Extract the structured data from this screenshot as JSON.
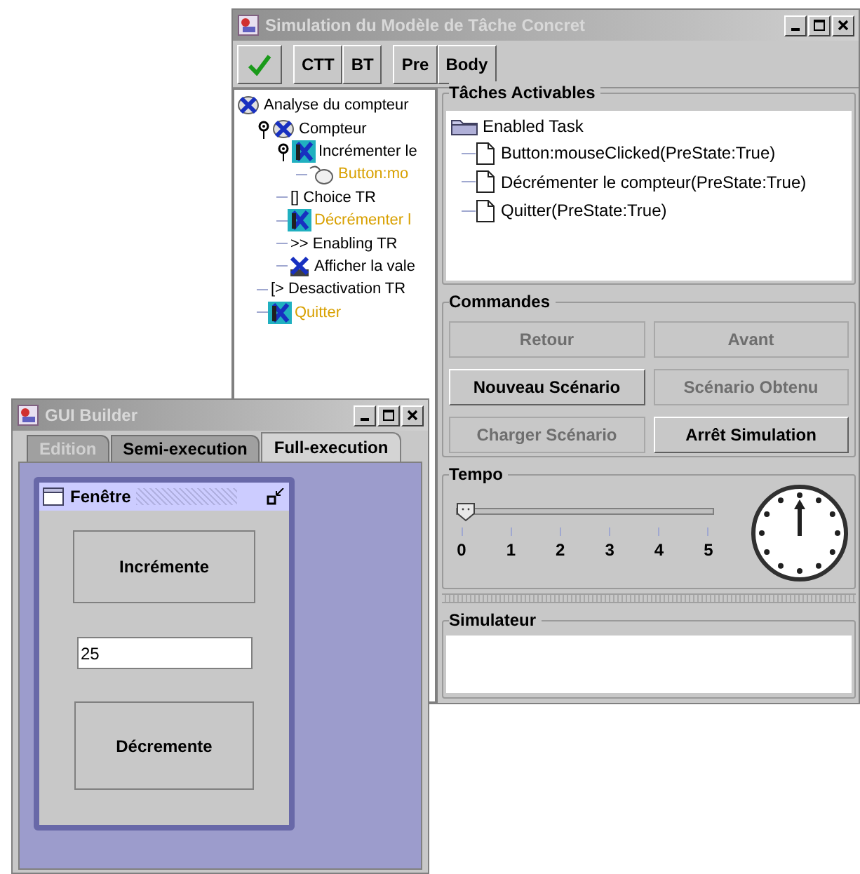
{
  "main_window": {
    "title": "Simulation du Modèle de Tâche Concret",
    "toolbar": [
      {
        "kind": "check"
      },
      {
        "kind": "text",
        "label": "CTT"
      },
      {
        "kind": "text",
        "label": "BT",
        "group_end": true
      },
      {
        "kind": "text",
        "label": "Pre"
      },
      {
        "kind": "text",
        "label": "Body"
      }
    ],
    "task_tree": [
      {
        "label": "Analyse du compteur",
        "kind": "abstract",
        "highlighted": false,
        "children": [
          {
            "label": "Compteur",
            "kind": "abstract",
            "highlighted": false,
            "expanded": true,
            "children": [
              {
                "label": "Incrémenter le",
                "kind": "interaction",
                "highlighted": false,
                "expanded": true,
                "children": [
                  {
                    "label": "Button:mo",
                    "kind": "user",
                    "highlighted": true
                  }
                ]
              },
              {
                "label": "[] Choice TR",
                "kind": "operator",
                "highlighted": false
              },
              {
                "label": "Décrémenter l",
                "kind": "interaction",
                "highlighted": true
              },
              {
                "label": ">> Enabling TR",
                "kind": "operator",
                "highlighted": false
              },
              {
                "label": "Afficher la vale",
                "kind": "application",
                "highlighted": false
              }
            ]
          },
          {
            "label": "[> Desactivation TR",
            "kind": "operator",
            "highlighted": false
          },
          {
            "label": "Quitter",
            "kind": "interaction",
            "highlighted": true
          }
        ]
      }
    ],
    "enabled_tasks": {
      "title": "Tâches Activables",
      "root": "Enabled Task",
      "items": [
        "Button:mouseClicked(PreState:True)",
        "Décrémenter le compteur(PreState:True)",
        "Quitter(PreState:True)"
      ]
    },
    "commands": {
      "title": "Commandes",
      "buttons": [
        {
          "label": "Retour",
          "disabled": true
        },
        {
          "label": "Avant",
          "disabled": true
        },
        {
          "label": "Nouveau Scénario",
          "disabled": false
        },
        {
          "label": "Scénario Obtenu",
          "disabled": true
        },
        {
          "label": "Charger Scénario",
          "disabled": true
        },
        {
          "label": "Arrêt Simulation",
          "disabled": false
        }
      ]
    },
    "tempo": {
      "title": "Tempo",
      "level": 0,
      "ticks": [
        "0",
        "1",
        "2",
        "3",
        "4",
        "5"
      ]
    },
    "simulator": {
      "title": "Simulateur"
    }
  },
  "gui_builder": {
    "title": "GUI Builder",
    "tabs": [
      {
        "label": "Edition",
        "selected": false,
        "disabled": true
      },
      {
        "label": "Semi-execution",
        "selected": false,
        "disabled": false
      },
      {
        "label": "Full-execution",
        "selected": true,
        "disabled": false
      }
    ],
    "frame": {
      "title": "Fenêtre",
      "increment_button": "Incrémente",
      "value": "25",
      "decrement_button": "Décremente"
    }
  }
}
